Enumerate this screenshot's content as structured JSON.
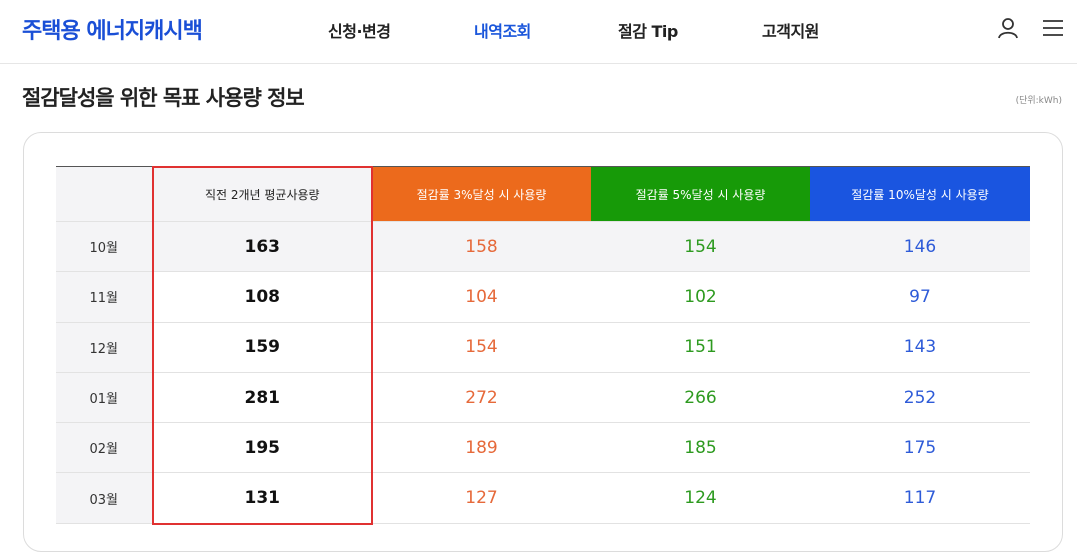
{
  "header": {
    "logo": "주택용 에너지캐시백",
    "nav": [
      {
        "label": "신청·변경",
        "active": false
      },
      {
        "label": "내역조회",
        "active": true
      },
      {
        "label": "절감 Tip",
        "active": false
      },
      {
        "label": "고객지원",
        "active": false
      }
    ]
  },
  "section": {
    "title": "절감달성을 위한 목표 사용량 정보",
    "unit": "(단위:kWh)"
  },
  "table": {
    "headers": {
      "month": "",
      "avg": "직전 2개년 평균사용량",
      "save3": "절감률 3%달성 시 사용량",
      "save5": "절감률 5%달성 시 사용량",
      "save10": "절감률 10%달성 시 사용량"
    },
    "rows": [
      {
        "month": "10월",
        "avg": "163",
        "save3": "158",
        "save5": "154",
        "save10": "146"
      },
      {
        "month": "11월",
        "avg": "108",
        "save3": "104",
        "save5": "102",
        "save10": "97"
      },
      {
        "month": "12월",
        "avg": "159",
        "save3": "154",
        "save5": "151",
        "save10": "143"
      },
      {
        "month": "01월",
        "avg": "281",
        "save3": "272",
        "save5": "266",
        "save10": "252"
      },
      {
        "month": "02월",
        "avg": "195",
        "save3": "189",
        "save5": "185",
        "save10": "175"
      },
      {
        "month": "03월",
        "avg": "131",
        "save3": "127",
        "save5": "124",
        "save10": "117"
      }
    ]
  },
  "colors": {
    "brand": "#1a4fd6",
    "save3": "#ec6a1c",
    "save5": "#179a08",
    "save10": "#1a55e0",
    "highlight": "#e03131"
  },
  "icons": {
    "user": "user-icon",
    "menu": "hamburger-menu-icon"
  }
}
